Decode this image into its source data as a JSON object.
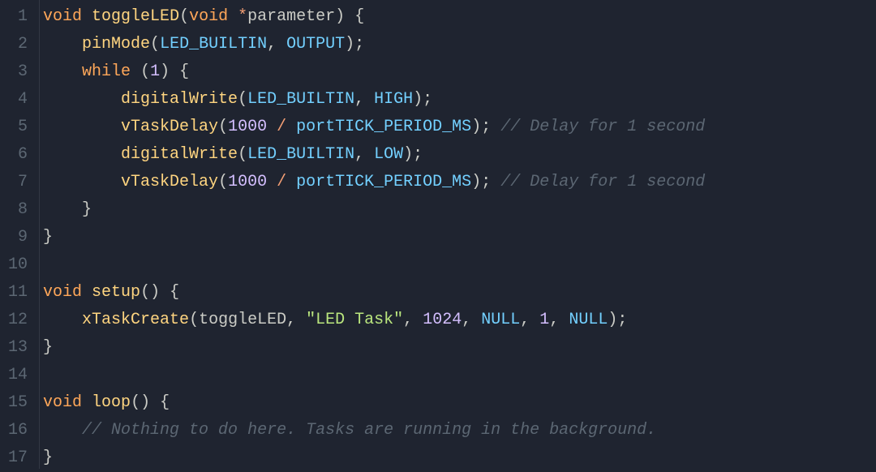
{
  "lineNumbers": [
    "1",
    "2",
    "3",
    "4",
    "5",
    "6",
    "7",
    "8",
    "9",
    "10",
    "11",
    "12",
    "13",
    "14",
    "15",
    "16",
    "17"
  ],
  "tokens": {
    "kw_void": "void",
    "kw_while": "while",
    "fn_toggleLED": "toggleLED",
    "fn_pinMode": "pinMode",
    "fn_digitalWrite": "digitalWrite",
    "fn_vTaskDelay": "vTaskDelay",
    "fn_setup": "setup",
    "fn_xTaskCreate": "xTaskCreate",
    "fn_loop": "loop",
    "id_parameter": "parameter",
    "c_LED_BUILTIN": "LED_BUILTIN",
    "c_OUTPUT": "OUTPUT",
    "c_HIGH": "HIGH",
    "c_LOW": "LOW",
    "c_portTICK": "portTICK_PERIOD_MS",
    "c_NULL": "NULL",
    "num_1": "1",
    "num_1000": "1000",
    "num_1024": "1024",
    "str_LEDTask": "\"LED Task\"",
    "cm_delay": "// Delay for 1 second",
    "cm_nothing": "// Nothing to do here. Tasks are running in the background.",
    "op_star": "*",
    "op_slash": "/",
    "p_open": "(",
    "p_close": ")",
    "b_open": "{",
    "b_close": "}",
    "comma": ",",
    "semi": ";",
    "sp": " ",
    "ind1": "    ",
    "ind2": "        ",
    "guide1": "    ",
    "guide2": "        "
  }
}
